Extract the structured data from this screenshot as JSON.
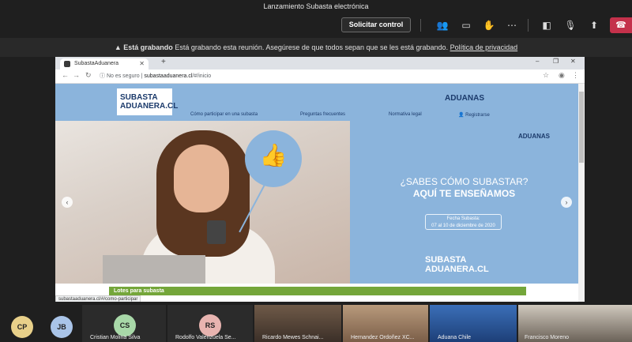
{
  "meeting": {
    "title": "Lanzamiento Subasta electrónica",
    "control_label": "Solicitar control",
    "recording_title": "Está grabando",
    "recording_text": "Está grabando esta reunión. Asegúrese de que todos sepan que se les está grabando.",
    "privacy_link": "Política de privacidad",
    "icons": [
      "people-icon",
      "chat-icon",
      "raise-hand-icon",
      "more-icon",
      "camera-off-icon",
      "mic-off-icon",
      "share-icon",
      "hangup-icon"
    ]
  },
  "browser": {
    "tab_title": "SubastaAduanera",
    "not_secure": "No es seguro",
    "url_domain": "subastaaduanera.cl",
    "url_path": "/#/inicio",
    "status_url": "subastaaduanera.cl/#/como-participar"
  },
  "site": {
    "logo_line1": "SUBASTA",
    "logo_line2": "ADUANERA.CL",
    "aduanas": "ADUANAS",
    "nav": [
      "Cómo participar en una subasta",
      "Preguntas frecuentes",
      "Normativa legal",
      "Registrarse"
    ],
    "hero_question": "¿SABES CÓMO SUBASTAR?",
    "hero_answer": "AQUÍ TE ENSEÑAMOS",
    "fecha_label": "Fecha Subasta:",
    "fecha_value": "07 al 10 de diciembre de 2020",
    "hero_logo_line1": "SUBASTA",
    "hero_logo_line2": "ADUANERA.CL",
    "lotes": "Lotes para subasta"
  },
  "participants": [
    {
      "initials": "CP",
      "color": "#e8d08a"
    },
    {
      "initials": "JB",
      "color": "#a9c4e8"
    },
    {
      "initials": "CS",
      "color": "#a8d8a8",
      "name": "Cristian Molina Silva"
    },
    {
      "initials": "RS",
      "color": "#e8b4b0",
      "name": "Rodolfo Valenzuela Se..."
    },
    {
      "name": "Ricardo Mewes Schnai..."
    },
    {
      "name": "Hernandez Ordoñez XC..."
    },
    {
      "name": "Aduana Chile"
    },
    {
      "name": "Francisco Moreno"
    }
  ]
}
